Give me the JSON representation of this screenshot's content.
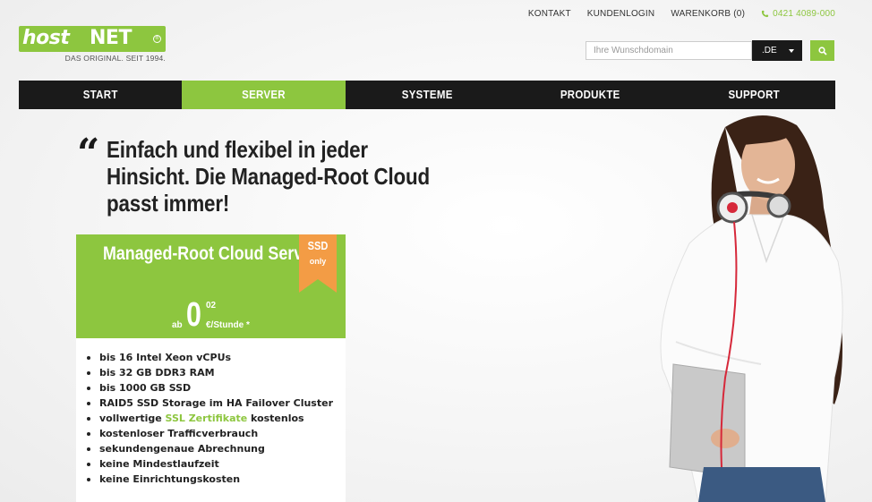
{
  "toplinks": {
    "contact": "KONTAKT",
    "login": "KUNDENLOGIN",
    "cart": "WARENKORB (0)",
    "phone": "0421 4089-000"
  },
  "logo": {
    "word_host": "host",
    "word_net": "NET",
    "registered": "®",
    "tagline": "DAS ORIGINAL. SEIT 1994."
  },
  "search": {
    "placeholder": "Ihre Wunschdomain",
    "tld": ".DE"
  },
  "nav": {
    "items": [
      {
        "label": "START"
      },
      {
        "label": "SERVER"
      },
      {
        "label": "SYSTEME"
      },
      {
        "label": "PRODUKTE"
      },
      {
        "label": "SUPPORT"
      }
    ],
    "active": "SERVER"
  },
  "hero": {
    "quote_mark": "“",
    "headline": "Einfach und flexibel in jeder Hinsicht. Die Managed-Root Cloud passt immer!"
  },
  "product": {
    "title": "Managed-Root Cloud Server",
    "ribbon_top": "SSD",
    "ribbon_bottom": "only",
    "price_prefix": "ab",
    "price_main": "0",
    "price_cents": "02",
    "price_unit": "€/Stunde *",
    "features": [
      "bis 16 Intel Xeon vCPUs",
      "bis 32 GB DDR3 RAM",
      "bis 1000 GB SSD",
      "RAID5 SSD Storage im HA Failover Cluster",
      "vollwertige ",
      "kostenloser Trafficverbrauch",
      "sekundengenaue Abrechnung",
      "keine Mindestlaufzeit",
      "keine Einrichtungskosten"
    ],
    "ssl_link": "SSL Zertifikate",
    "ssl_suffix": " kostenlos"
  },
  "colors": {
    "accent": "#8dc63f",
    "nav_bg": "#1a1a1a",
    "ribbon": "#f39c45"
  },
  "icons": {
    "phone": "phone-icon",
    "search": "search-icon",
    "caret": "caret-down-icon"
  }
}
